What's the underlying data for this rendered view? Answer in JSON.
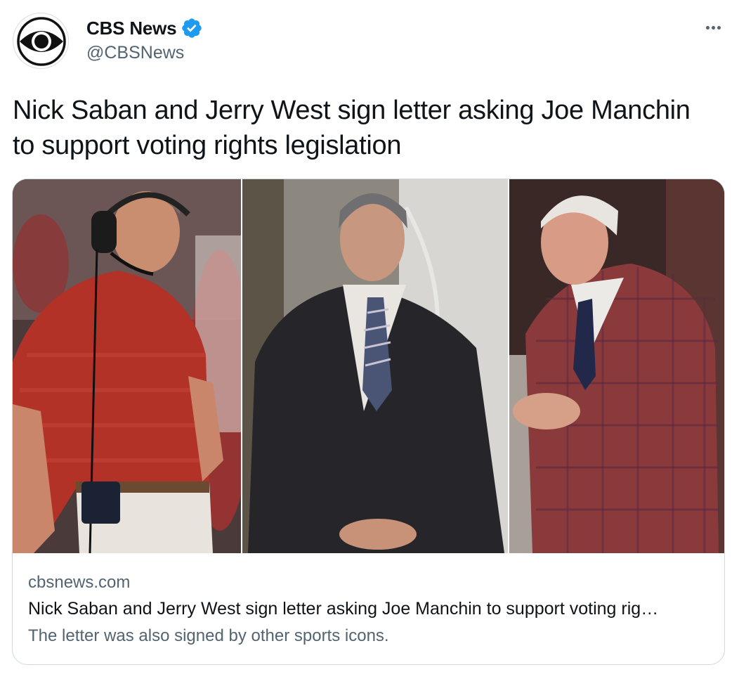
{
  "author": {
    "display_name": "CBS News",
    "handle": "@CBSNews",
    "verified": true
  },
  "icons": {
    "avatar": "cbs-eye-logo-icon",
    "verified": "verified-badge-icon",
    "more": "more-horizontal-icon"
  },
  "colors": {
    "verified_blue": "#1d9bf0",
    "secondary_text": "#536471",
    "primary_text": "#0f1419",
    "card_border": "#cfd9de"
  },
  "tweet": {
    "text": "Nick Saban and Jerry West sign letter asking Joe Manchin to support voting rights legislation"
  },
  "card": {
    "domain": "cbsnews.com",
    "title": "Nick Saban and Jerry West sign letter asking Joe Manchin to support voting rig…",
    "description": "The letter was also signed by other sports icons."
  }
}
